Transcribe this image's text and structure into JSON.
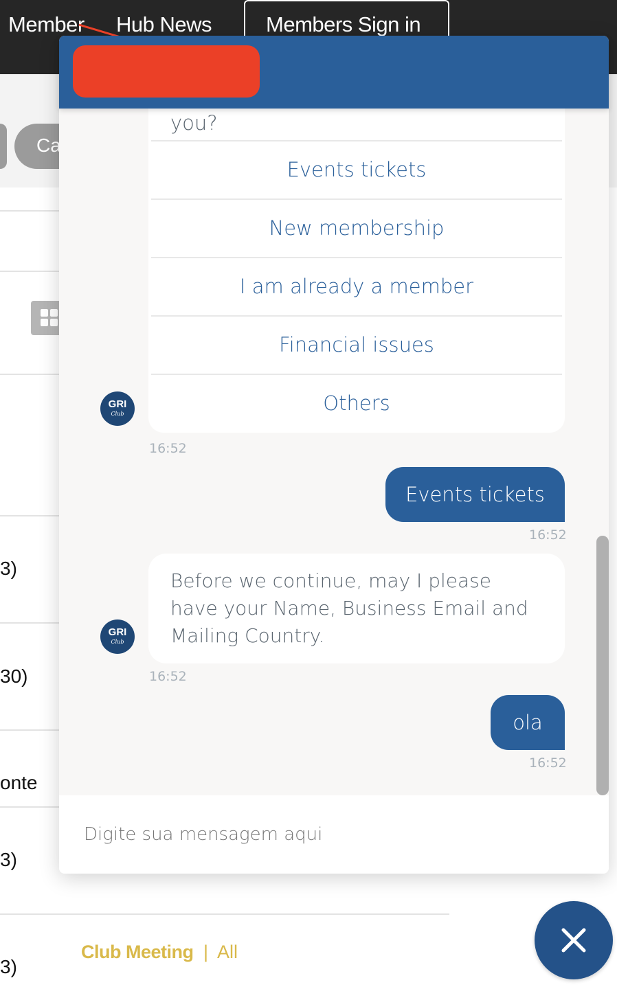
{
  "nav": {
    "items": [
      "Member",
      "Hub News"
    ],
    "signin": "Members Sign in"
  },
  "background": {
    "pill": "Ca",
    "row_fragments": [
      "3)",
      "30)",
      "onte",
      "3)",
      "3)"
    ],
    "category": "Club Meeting",
    "separator": "|",
    "all": "All"
  },
  "chat": {
    "header_redacted": true,
    "question_tail": "you?",
    "options": [
      "Events tickets",
      "New membership",
      "I am already a member",
      "Financial issues",
      "Others"
    ],
    "bot_avatar": {
      "brand": "GRI",
      "sub": "Club"
    },
    "messages": [
      {
        "from": "bot",
        "type": "options",
        "time": "16:52"
      },
      {
        "from": "user",
        "text": "Events tickets",
        "time": "16:52"
      },
      {
        "from": "bot",
        "text": "Before we continue, may I please have your Name, Business Email and Mailing Country.",
        "time": "16:52"
      },
      {
        "from": "user",
        "text": "ola",
        "time": "16:52"
      }
    ],
    "input_placeholder": "Digite sua mensagem aqui",
    "close_icon": "close-icon"
  },
  "colors": {
    "header": "#2a5f9a",
    "redaction": "#eb4027",
    "accent": "#d9b94a",
    "topbar": "#262626"
  }
}
